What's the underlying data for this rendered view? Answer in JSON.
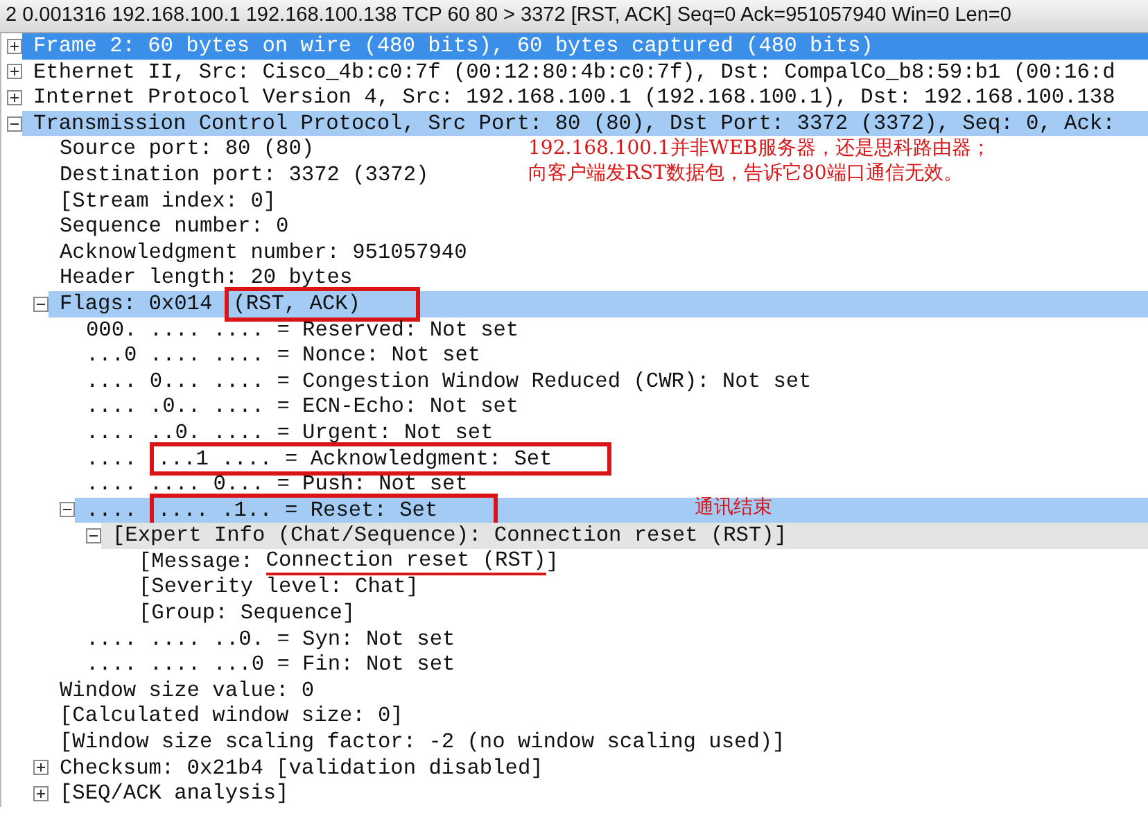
{
  "window": {
    "title": "2 0.001316 192.168.100.1 192.168.100.138 TCP 60 80 > 3372 [RST, ACK] Seq=0 Ack=951057940 Win=0 Len=0"
  },
  "tree": [
    {
      "segments": [
        {
          "text": "Frame 2: 60 bytes on wire (480 bits), 60 bytes captured (480 bits)"
        }
      ],
      "expanded": false,
      "selected": true,
      "highlighted": false
    },
    {
      "segments": [
        {
          "text": "Ethernet II, Src: Cisco_4b:c0:7f (00:12:80:4b:c0:7f), Dst: CompalCo_b8:59:b1 (00:16:d"
        }
      ],
      "expanded": false,
      "selected": false,
      "highlighted": false
    },
    {
      "segments": [
        {
          "text": "Internet Protocol Version 4, Src: 192.168.100.1 (192.168.100.1), Dst: 192.168.100.138"
        }
      ],
      "expanded": false,
      "selected": false,
      "highlighted": false
    },
    {
      "segments": [
        {
          "text": "Transmission Control Protocol, Src Port: 80 (80), Dst Port: 3372 (3372), Seq: 0, Ack:"
        }
      ],
      "expanded": true,
      "selected": false,
      "highlighted": true,
      "children": [
        {
          "segments": [
            {
              "text": "Source port: 80 (80)"
            }
          ],
          "selected": false,
          "highlighted": false,
          "note": {
            "kind": "callout",
            "lines": [
              "192.168.100.1并非WEB服务器，还是思科路由器；",
              "向客户端发RST数据包，告诉它80端口通信无效。"
            ]
          }
        },
        {
          "segments": [
            {
              "text": "Destination port: 3372 (3372)"
            }
          ],
          "selected": false,
          "highlighted": false
        },
        {
          "segments": [
            {
              "text": "[Stream index: 0]"
            }
          ],
          "selected": false,
          "highlighted": false
        },
        {
          "segments": [
            {
              "text": "Sequence number: 0"
            }
          ],
          "selected": false,
          "highlighted": false
        },
        {
          "segments": [
            {
              "text": "Acknowledgment number: 951057940"
            }
          ],
          "selected": false,
          "highlighted": false
        },
        {
          "segments": [
            {
              "text": "Header length: 20 bytes"
            }
          ],
          "selected": false,
          "highlighted": false
        },
        {
          "segments": [
            {
              "text": "Flags: 0x014"
            },
            {
              "text": "(RST, ACK)",
              "boxed": true
            }
          ],
          "expanded": true,
          "selected": false,
          "highlighted": true,
          "children": [
            {
              "segments": [
                {
                  "text": "000. .... .... = Reserved: Not set"
                }
              ],
              "selected": false,
              "highlighted": false
            },
            {
              "segments": [
                {
                  "text": "...0 .... .... = Nonce: Not set"
                }
              ],
              "selected": false,
              "highlighted": false
            },
            {
              "segments": [
                {
                  "text": ".... 0... .... = Congestion Window Reduced (CWR): Not set"
                }
              ],
              "selected": false,
              "highlighted": false
            },
            {
              "segments": [
                {
                  "text": ".... .0.. .... = ECN-Echo: Not set"
                }
              ],
              "selected": false,
              "highlighted": false
            },
            {
              "segments": [
                {
                  "text": ".... ..0. .... = Urgent: Not set"
                }
              ],
              "selected": false,
              "highlighted": false
            },
            {
              "segments": [
                {
                  "text": "...."
                },
                {
                  "text": "...1 .... = Acknowledgment: Set",
                  "boxed": true
                }
              ],
              "selected": false,
              "highlighted": false
            },
            {
              "segments": [
                {
                  "text": ".... .... 0... = Push: Not set"
                }
              ],
              "selected": false,
              "highlighted": false
            },
            {
              "segments": [
                {
                  "text": "...."
                },
                {
                  "text": ".... .1.. = Reset: Set",
                  "boxed": true
                }
              ],
              "expanded": true,
              "selected": false,
              "highlighted": true,
              "note": {
                "kind": "tag",
                "lines": [
                  "通讯结束"
                ]
              },
              "children": [
                {
                  "segments": [
                    {
                      "text": "[Expert Info (Chat/Sequence): Connection reset (RST)]"
                    }
                  ],
                  "expanded": true,
                  "selected": false,
                  "highlighted": false,
                  "shaded": true,
                  "children": [
                    {
                      "segments": [
                        {
                          "text": "[Message: "
                        },
                        {
                          "text": "Connection reset (RST)",
                          "underlined": true
                        },
                        {
                          "text": "]"
                        }
                      ],
                      "selected": false,
                      "highlighted": false
                    },
                    {
                      "segments": [
                        {
                          "text": "[Severity level: Chat]"
                        }
                      ],
                      "selected": false,
                      "highlighted": false
                    },
                    {
                      "segments": [
                        {
                          "text": "[Group: Sequence]"
                        }
                      ],
                      "selected": false,
                      "highlighted": false
                    }
                  ]
                }
              ]
            },
            {
              "segments": [
                {
                  "text": ".... .... ..0. = Syn: Not set"
                }
              ],
              "selected": false,
              "highlighted": false
            },
            {
              "segments": [
                {
                  "text": ".... .... ...0 = Fin: Not set"
                }
              ],
              "selected": false,
              "highlighted": false
            }
          ]
        },
        {
          "segments": [
            {
              "text": "Window size value: 0"
            }
          ],
          "selected": false,
          "highlighted": false
        },
        {
          "segments": [
            {
              "text": "[Calculated window size: 0]"
            }
          ],
          "selected": false,
          "highlighted": false
        },
        {
          "segments": [
            {
              "text": "[Window size scaling factor: -2 (no window scaling used)]"
            }
          ],
          "selected": false,
          "highlighted": false
        },
        {
          "segments": [
            {
              "text": "Checksum: 0x21b4 [validation disabled]"
            }
          ],
          "expanded": false,
          "selected": false,
          "highlighted": false
        },
        {
          "segments": [
            {
              "text": "[SEQ/ACK analysis]"
            }
          ],
          "expanded": false,
          "selected": false,
          "highlighted": false
        }
      ]
    }
  ]
}
